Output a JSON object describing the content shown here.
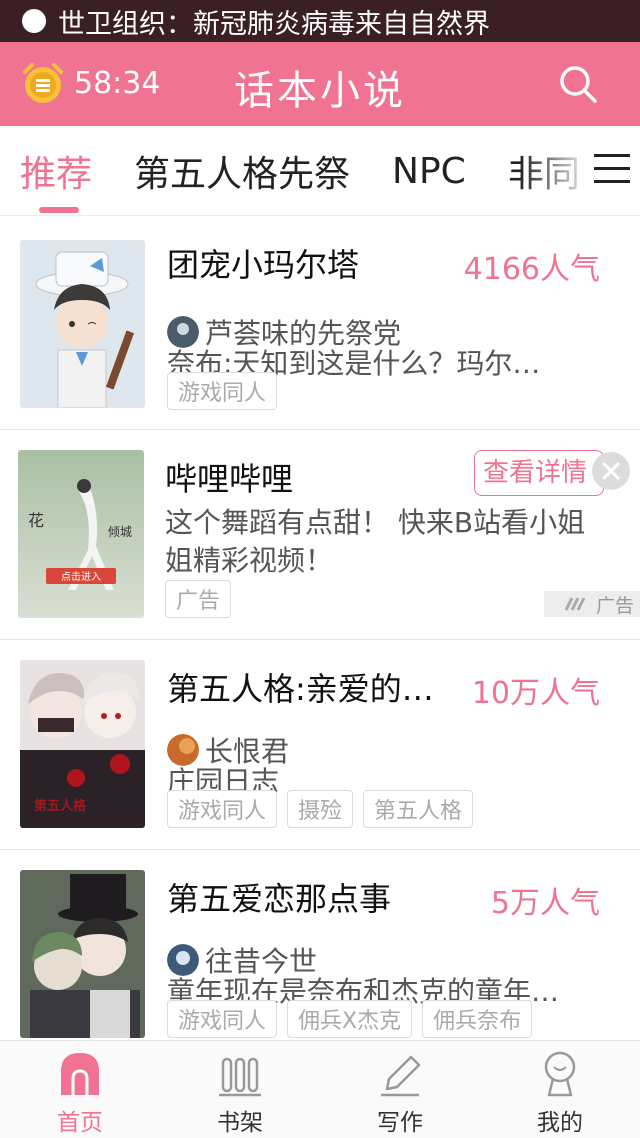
{
  "status_bar": {
    "notification": "世卫组织：新冠肺炎病毒来自自然界"
  },
  "header": {
    "timer": "58:34",
    "title": "话本小说",
    "timer_icon": "alarm-coin-icon",
    "search_icon": "search-icon"
  },
  "tabs": [
    {
      "label": "推荐",
      "active": true
    },
    {
      "label": "第五人格先祭"
    },
    {
      "label": "NPC"
    },
    {
      "label": "非同"
    }
  ],
  "menu_icon": "menu-icon",
  "books": [
    {
      "title": "团宠小玛尔塔",
      "popularity": "4166人气",
      "author": "芦荟味的先祭党",
      "description": "奈布:天知到这是什么？玛尔…",
      "tags": [
        "游戏同人"
      ]
    },
    {
      "title": "第五人格:亲爱的…",
      "popularity": "10万人气",
      "author": "长恨君",
      "description": "庄园日志",
      "tags": [
        "游戏同人",
        "摄殓",
        "第五人格"
      ]
    },
    {
      "title": "第五爱恋那点事",
      "popularity": "5万人气",
      "author": "往昔今世",
      "description": "童年现在是奈布和杰克的童年…",
      "tags": [
        "游戏同人",
        "佣兵X杰克",
        "佣兵奈布"
      ]
    }
  ],
  "ad": {
    "title": "哔哩哔哩",
    "description": "这个舞蹈有点甜！ 快来B站看小姐姐精彩视频！",
    "button": "查看详情",
    "tag": "广告",
    "badge": "广告",
    "image_text_1": "花",
    "image_text_2": "倾城",
    "image_button": "点击进入"
  },
  "bottom_nav": [
    {
      "label": "首页",
      "icon": "home-icon",
      "active": true
    },
    {
      "label": "书架",
      "icon": "bookshelf-icon"
    },
    {
      "label": "写作",
      "icon": "pen-icon"
    },
    {
      "label": "我的",
      "icon": "profile-icon"
    }
  ],
  "colors": {
    "accent": "#f07391",
    "status_bar": "#3a1f24"
  }
}
